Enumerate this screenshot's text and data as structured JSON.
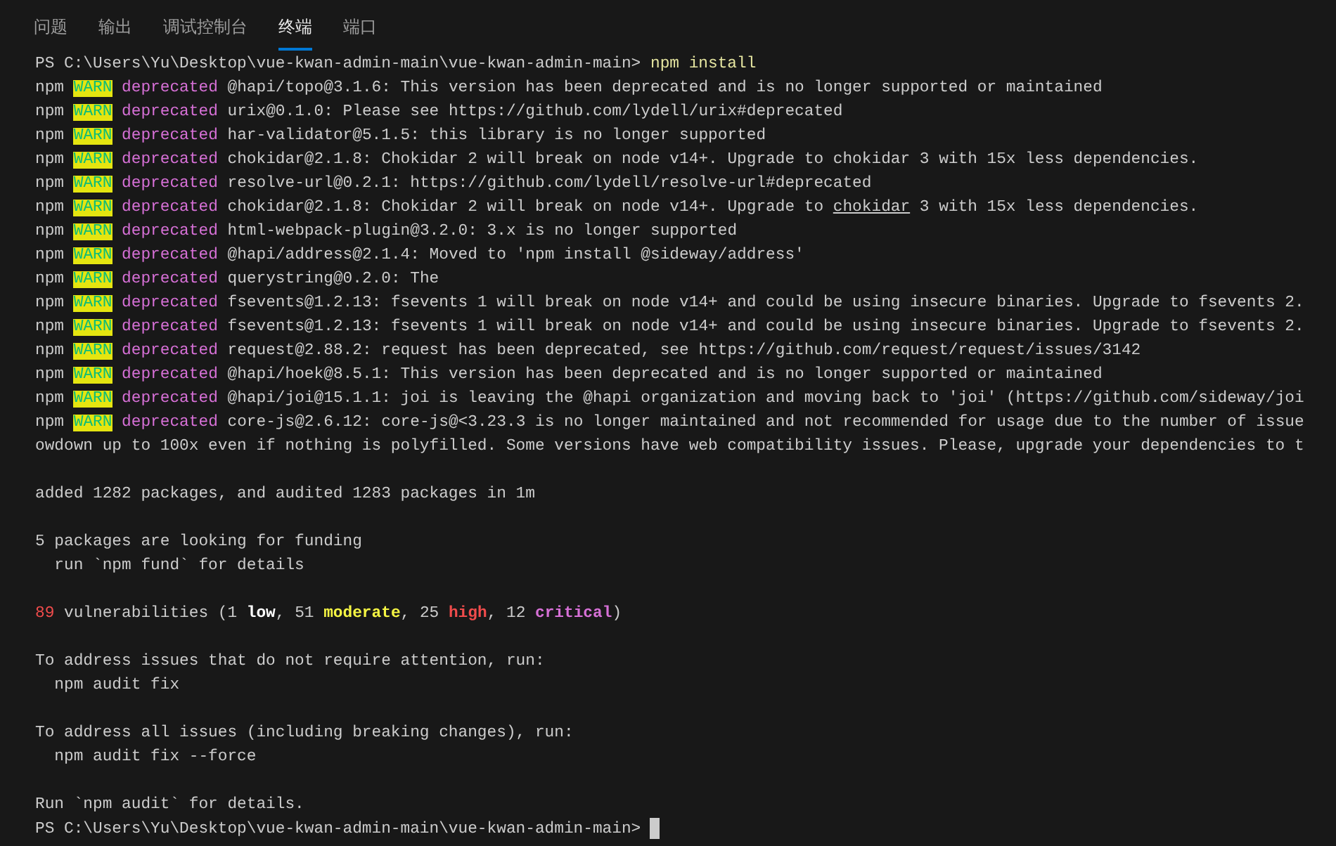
{
  "tabs": [
    {
      "label": "问题",
      "selected": false
    },
    {
      "label": "输出",
      "selected": false
    },
    {
      "label": "调试控制台",
      "selected": false
    },
    {
      "label": "终端",
      "selected": true
    },
    {
      "label": "端口",
      "selected": false
    }
  ],
  "terminal": {
    "lines": [
      {
        "kind": "prompt",
        "path": "PS C:\\Users\\Yu\\Desktop\\vue-kwan-admin-main\\vue-kwan-admin-main>",
        "command": "npm install",
        "cursor": false
      },
      {
        "kind": "warn",
        "prefix": "npm",
        "level": "WARN",
        "tag": "deprecated",
        "segments": [
          {
            "text": "@hapi/topo@3.1.6: This version has been deprecated and is no longer supported or maintained",
            "link": false
          }
        ]
      },
      {
        "kind": "warn",
        "prefix": "npm",
        "level": "WARN",
        "tag": "deprecated",
        "segments": [
          {
            "text": "urix@0.1.0: Please see https://github.com/lydell/urix#deprecated",
            "link": false
          }
        ]
      },
      {
        "kind": "warn",
        "prefix": "npm",
        "level": "WARN",
        "tag": "deprecated",
        "segments": [
          {
            "text": "har-validator@5.1.5: this library is no longer supported",
            "link": false
          }
        ]
      },
      {
        "kind": "warn",
        "prefix": "npm",
        "level": "WARN",
        "tag": "deprecated",
        "segments": [
          {
            "text": "chokidar@2.1.8: Chokidar 2 will break on node v14+. Upgrade to chokidar 3 with 15x less dependencies.",
            "link": false
          }
        ]
      },
      {
        "kind": "warn",
        "prefix": "npm",
        "level": "WARN",
        "tag": "deprecated",
        "segments": [
          {
            "text": "resolve-url@0.2.1: https://github.com/lydell/resolve-url#deprecated",
            "link": false
          }
        ]
      },
      {
        "kind": "warn",
        "prefix": "npm",
        "level": "WARN",
        "tag": "deprecated",
        "segments": [
          {
            "text": "chokidar@2.1.8: Chokidar 2 will break on node v14+. Upgrade to ",
            "link": false
          },
          {
            "text": "chokidar",
            "link": true
          },
          {
            "text": " 3 with 15x less dependencies.",
            "link": false
          }
        ]
      },
      {
        "kind": "warn",
        "prefix": "npm",
        "level": "WARN",
        "tag": "deprecated",
        "segments": [
          {
            "text": "html-webpack-plugin@3.2.0: 3.x is no longer supported",
            "link": false
          }
        ]
      },
      {
        "kind": "warn",
        "prefix": "npm",
        "level": "WARN",
        "tag": "deprecated",
        "segments": [
          {
            "text": "@hapi/address@2.1.4: Moved to 'npm install @sideway/address'",
            "link": false
          }
        ]
      },
      {
        "kind": "warn",
        "prefix": "npm",
        "level": "WARN",
        "tag": "deprecated",
        "segments": [
          {
            "text": "querystring@0.2.0: The",
            "link": false
          }
        ]
      },
      {
        "kind": "warn",
        "prefix": "npm",
        "level": "WARN",
        "tag": "deprecated",
        "segments": [
          {
            "text": "fsevents@1.2.13: fsevents 1 will break on node v14+ and could be using insecure binaries. Upgrade to fsevents 2.",
            "link": false
          }
        ]
      },
      {
        "kind": "warn",
        "prefix": "npm",
        "level": "WARN",
        "tag": "deprecated",
        "segments": [
          {
            "text": "fsevents@1.2.13: fsevents 1 will break on node v14+ and could be using insecure binaries. Upgrade to fsevents 2.",
            "link": false
          }
        ]
      },
      {
        "kind": "warn",
        "prefix": "npm",
        "level": "WARN",
        "tag": "deprecated",
        "segments": [
          {
            "text": "request@2.88.2: request has been deprecated, see https://github.com/request/request/issues/3142",
            "link": false
          }
        ]
      },
      {
        "kind": "warn",
        "prefix": "npm",
        "level": "WARN",
        "tag": "deprecated",
        "segments": [
          {
            "text": "@hapi/hoek@8.5.1: This version has been deprecated and is no longer supported or maintained",
            "link": false
          }
        ]
      },
      {
        "kind": "warn",
        "prefix": "npm",
        "level": "WARN",
        "tag": "deprecated",
        "segments": [
          {
            "text": "@hapi/joi@15.1.1: joi is leaving the @hapi organization and moving back to 'joi' (https://github.com/sideway/joi",
            "link": false
          }
        ]
      },
      {
        "kind": "warn",
        "prefix": "npm",
        "level": "WARN",
        "tag": "deprecated",
        "segments": [
          {
            "text": "core-js@2.6.12: core-js@<3.23.3 is no longer maintained and not recommended for usage due to the number of issue",
            "link": false
          }
        ]
      },
      {
        "kind": "text",
        "text": "owdown up to 100x even if nothing is polyfilled. Some versions have web compatibility issues. Please, upgrade your dependencies to t"
      },
      {
        "kind": "blank"
      },
      {
        "kind": "text",
        "text": "added 1282 packages, and audited 1283 packages in 1m"
      },
      {
        "kind": "blank"
      },
      {
        "kind": "text",
        "text": "5 packages are looking for funding"
      },
      {
        "kind": "text",
        "text": "  run `npm fund` for details"
      },
      {
        "kind": "blank"
      },
      {
        "kind": "colored",
        "segments": [
          {
            "text": "89",
            "color": "#f14c4c",
            "bold": false
          },
          {
            "text": " vulnerabilities (1 ",
            "color": "#cccccc",
            "bold": false
          },
          {
            "text": "low",
            "color": "#ffffff",
            "bold": true
          },
          {
            "text": ", 51 ",
            "color": "#cccccc",
            "bold": false
          },
          {
            "text": "moderate",
            "color": "#f5f543",
            "bold": true
          },
          {
            "text": ", 25 ",
            "color": "#cccccc",
            "bold": false
          },
          {
            "text": "high",
            "color": "#f14c4c",
            "bold": true
          },
          {
            "text": ", 12 ",
            "color": "#cccccc",
            "bold": false
          },
          {
            "text": "critical",
            "color": "#d670d6",
            "bold": true
          },
          {
            "text": ")",
            "color": "#cccccc",
            "bold": false
          }
        ]
      },
      {
        "kind": "blank"
      },
      {
        "kind": "text",
        "text": "To address issues that do not require attention, run:"
      },
      {
        "kind": "text",
        "text": "  npm audit fix"
      },
      {
        "kind": "blank"
      },
      {
        "kind": "text",
        "text": "To address all issues (including breaking changes), run:"
      },
      {
        "kind": "text",
        "text": "  npm audit fix --force"
      },
      {
        "kind": "blank"
      },
      {
        "kind": "text",
        "text": "Run `npm audit` for details."
      },
      {
        "kind": "prompt",
        "path": "PS C:\\Users\\Yu\\Desktop\\vue-kwan-admin-main\\vue-kwan-admin-main>",
        "cursor": true
      }
    ]
  }
}
